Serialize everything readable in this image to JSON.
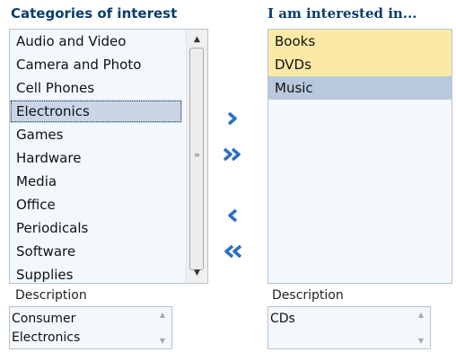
{
  "available": {
    "header": "Categories of interest",
    "items": [
      "Audio and Video",
      "Camera and Photo",
      "Cell Phones",
      "Electronics",
      "Games",
      "Hardware",
      "Media",
      "Office",
      "Periodicals",
      "Software",
      "Supplies"
    ],
    "focused_item": "Electronics",
    "description_label": "Description",
    "description_text": "Consumer\nElectronics"
  },
  "selected": {
    "header": "I am interested in...",
    "items": [
      "Books",
      "DVDs",
      "Music"
    ],
    "highlighted_items": [
      "Books",
      "DVDs"
    ],
    "selected_item": "Music",
    "description_label": "Description",
    "description_text": "CDs"
  },
  "shuttle": {
    "move_icon": "chevron-right-icon",
    "move_all_icon": "double-chevron-right-icon",
    "remove_icon": "chevron-left-icon",
    "remove_all_icon": "double-chevron-left-icon"
  },
  "colors": {
    "header": "#0b3d6b",
    "list_bg": "#f3f8fd",
    "highlight": "#fce9a6",
    "selection": "#b9c9dd",
    "arrow": "#2a6fc4"
  }
}
